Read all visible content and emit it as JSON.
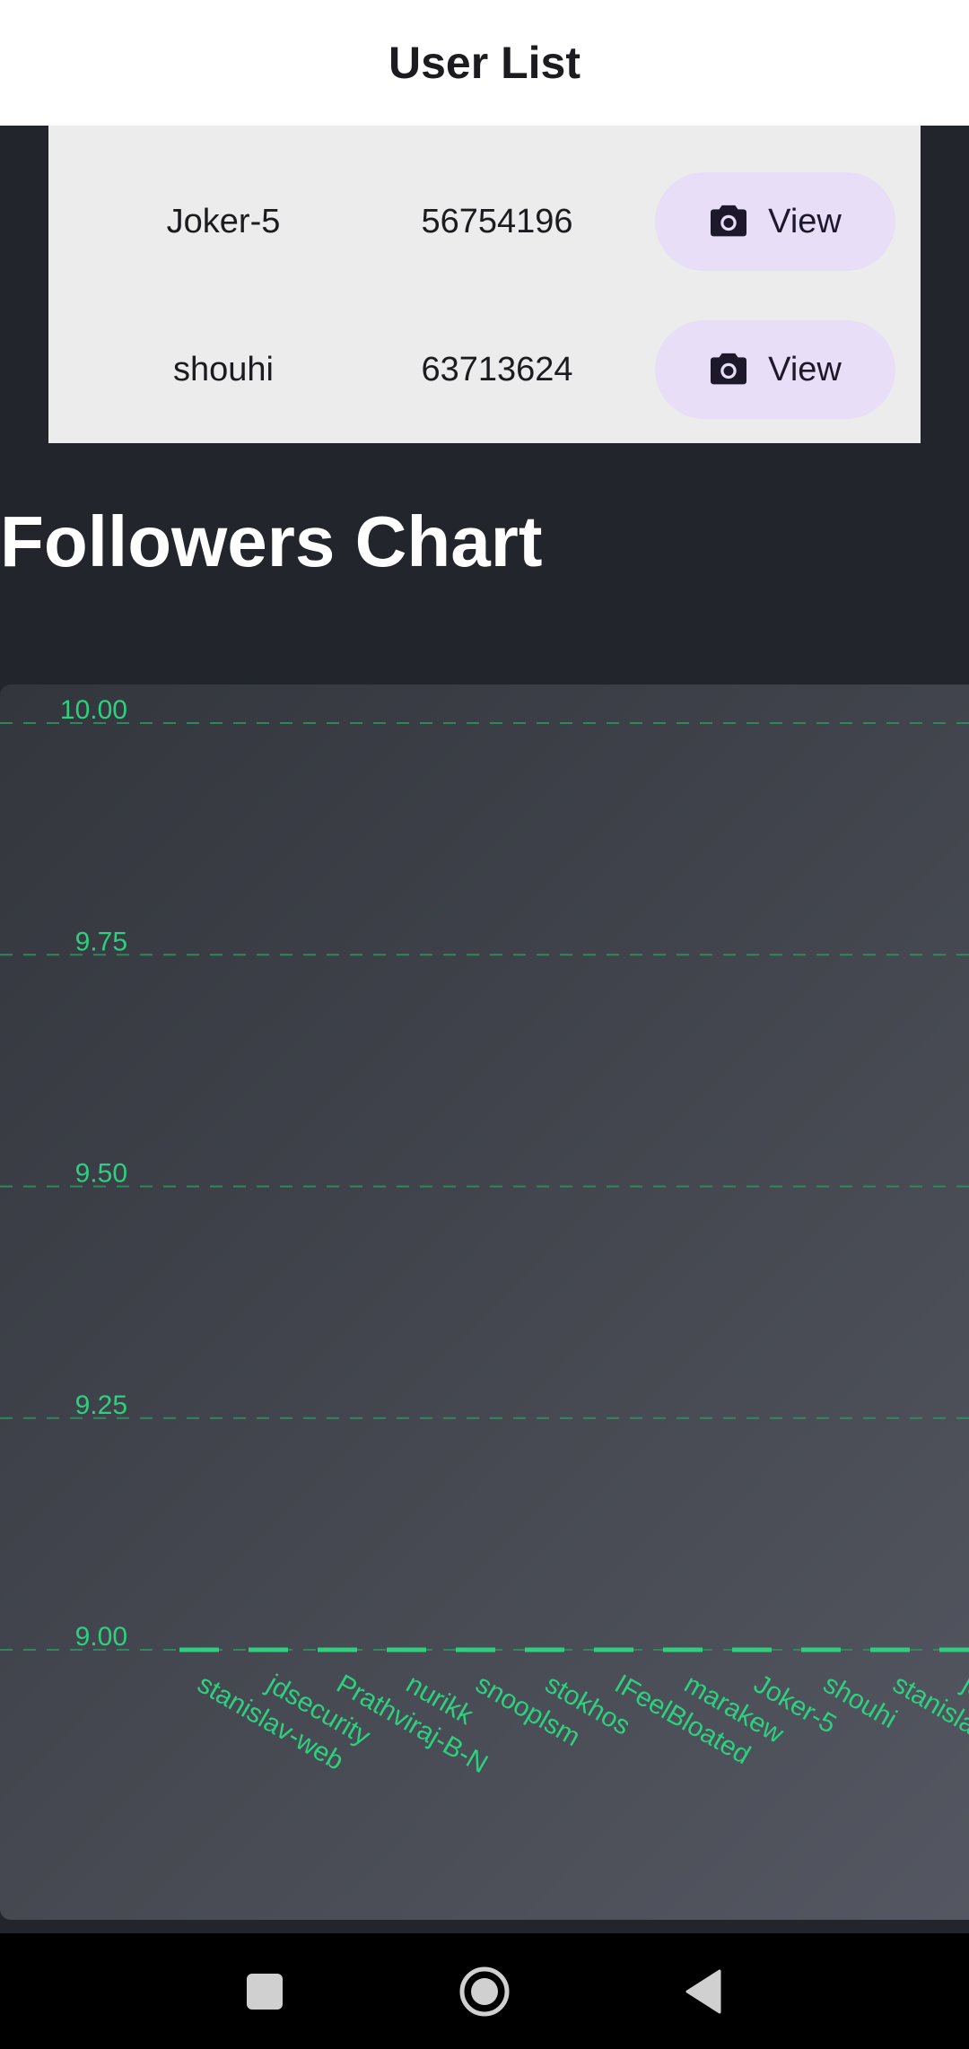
{
  "app_bar": {
    "title": "User List"
  },
  "user_table": {
    "rows": [
      {
        "name": "Joker-5",
        "id": "56754196",
        "action_label": "View",
        "action_icon": "camera-icon"
      },
      {
        "name": "shouhi",
        "id": "63713624",
        "action_label": "View",
        "action_icon": "camera-icon"
      }
    ]
  },
  "chart_section": {
    "title": "Followers Chart"
  },
  "chart_data": {
    "type": "line",
    "title": "",
    "xlabel": "",
    "ylabel": "",
    "categories": [
      "stanislav-web",
      "jdsecurity",
      "Prathviraj-B-N",
      "nurikk",
      "snooplsm",
      "stokhos",
      "IFeelBloated",
      "marakew",
      "Joker-5",
      "shouhi",
      "stanisla",
      "jd"
    ],
    "series": [
      {
        "values": [
          9,
          9,
          9,
          9,
          9,
          9,
          9,
          9,
          9,
          9,
          9,
          9
        ]
      }
    ],
    "ylim": [
      9.0,
      10.0
    ],
    "yticks": [
      "10.00",
      "9.75",
      "9.50",
      "9.25",
      "9.00"
    ],
    "grid": true,
    "colors": {
      "accent": "#2ecf7f",
      "grid": "#2f8f5e"
    }
  },
  "nav_bar": {
    "icons": [
      "recent-apps-icon",
      "home-icon",
      "back-icon"
    ]
  }
}
